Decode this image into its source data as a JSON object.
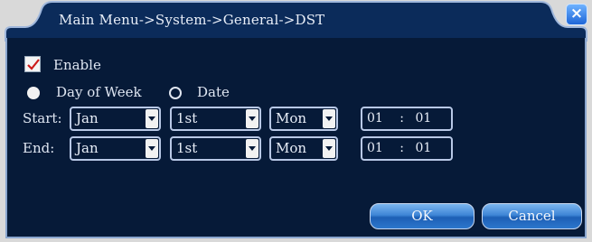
{
  "dialog": {
    "title": "Main Menu->System->General->DST",
    "close_label": "×"
  },
  "enable": {
    "label": "Enable",
    "checked": true
  },
  "mode": {
    "options": [
      {
        "label": "Day of Week",
        "selected": true
      },
      {
        "label": "Date",
        "selected": false
      }
    ]
  },
  "start": {
    "label": "Start:",
    "month": "Jan",
    "week": "1st",
    "day": "Mon",
    "hour": "01",
    "sep": ":",
    "minute": "01"
  },
  "end": {
    "label": "End:",
    "month": "Jan",
    "week": "1st",
    "day": "Mon",
    "hour": "01",
    "sep": ":",
    "minute": "01"
  },
  "buttons": {
    "ok": "OK",
    "cancel": "Cancel"
  },
  "colors": {
    "panel_bg": "#061a38",
    "title_bar": "#0b2b5a",
    "accent": "#3f86d6",
    "check_mark": "#cc1a1a"
  }
}
